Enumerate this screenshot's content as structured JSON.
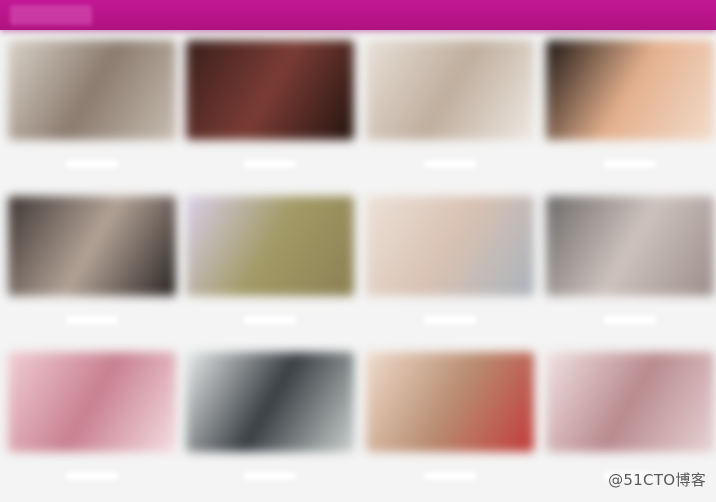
{
  "header": {
    "brand_label": ""
  },
  "gallery": {
    "items": [
      {
        "name": "photo-1",
        "colors": [
          "#d9d2c8",
          "#8b7b6e",
          "#c8beb2"
        ]
      },
      {
        "name": "photo-2",
        "colors": [
          "#3a1e1c",
          "#7a3c34",
          "#24130f"
        ]
      },
      {
        "name": "photo-3",
        "colors": [
          "#e8e0d8",
          "#bfae9d",
          "#efe9e3"
        ]
      },
      {
        "name": "photo-4",
        "colors": [
          "#1d1613",
          "#e4b08d",
          "#f2dccb"
        ]
      },
      {
        "name": "photo-5",
        "colors": [
          "#3e3633",
          "#b2a296",
          "#2a2422"
        ]
      },
      {
        "name": "photo-6",
        "colors": [
          "#d8cfe9",
          "#a29a66",
          "#8b7f52"
        ]
      },
      {
        "name": "photo-7",
        "colors": [
          "#ece1d8",
          "#d8c1b2",
          "#aab3bc"
        ]
      },
      {
        "name": "photo-8",
        "colors": [
          "#6d6a69",
          "#cdc2bd",
          "#9c8e89"
        ]
      },
      {
        "name": "photo-9",
        "colors": [
          "#f1ced4",
          "#c88090",
          "#f5dde2"
        ]
      },
      {
        "name": "photo-10",
        "colors": [
          "#e9ecec",
          "#3a3f44",
          "#cbd1cf"
        ]
      },
      {
        "name": "photo-11",
        "colors": [
          "#f0dccd",
          "#b98e72",
          "#c23a3a"
        ]
      },
      {
        "name": "photo-12",
        "colors": [
          "#f1e2e1",
          "#b98a8e",
          "#e7d3d3"
        ]
      }
    ]
  },
  "watermark": {
    "text": "@51CTO博客"
  }
}
